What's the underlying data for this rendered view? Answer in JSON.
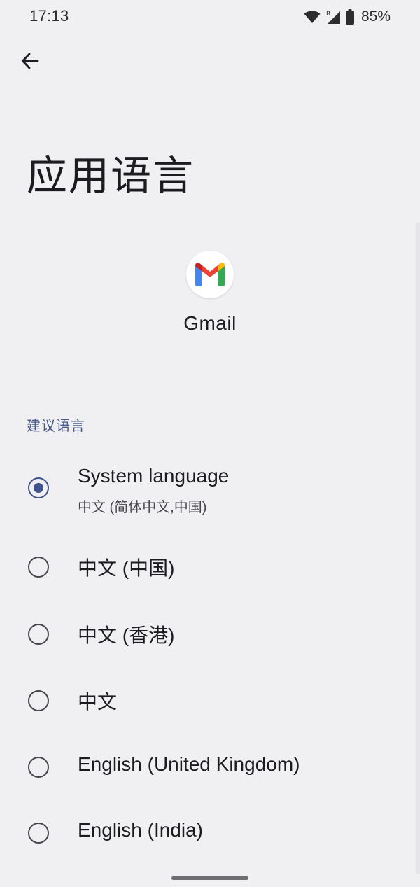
{
  "status_bar": {
    "time": "17:13",
    "battery": "85%",
    "icons": [
      "wifi-icon",
      "cell-signal-roaming-icon",
      "battery-icon"
    ]
  },
  "header": {
    "back_icon": "arrow-back-icon",
    "title": "应用语言"
  },
  "app": {
    "icon": "gmail-logo",
    "name": "Gmail"
  },
  "section": {
    "title": "建议语言"
  },
  "languages": [
    {
      "label": "System language",
      "subtitle": "中文 (简体中文,中国)",
      "selected": true
    },
    {
      "label": "中文 (中国)",
      "selected": false
    },
    {
      "label": "中文 (香港)",
      "selected": false
    },
    {
      "label": "中文",
      "selected": false
    },
    {
      "label": "English (United Kingdom)",
      "selected": false
    },
    {
      "label": "English (India)",
      "selected": false
    }
  ],
  "colors": {
    "background": "#f0f0f3",
    "accent": "#41558d",
    "section_header": "#4a5b8a"
  }
}
